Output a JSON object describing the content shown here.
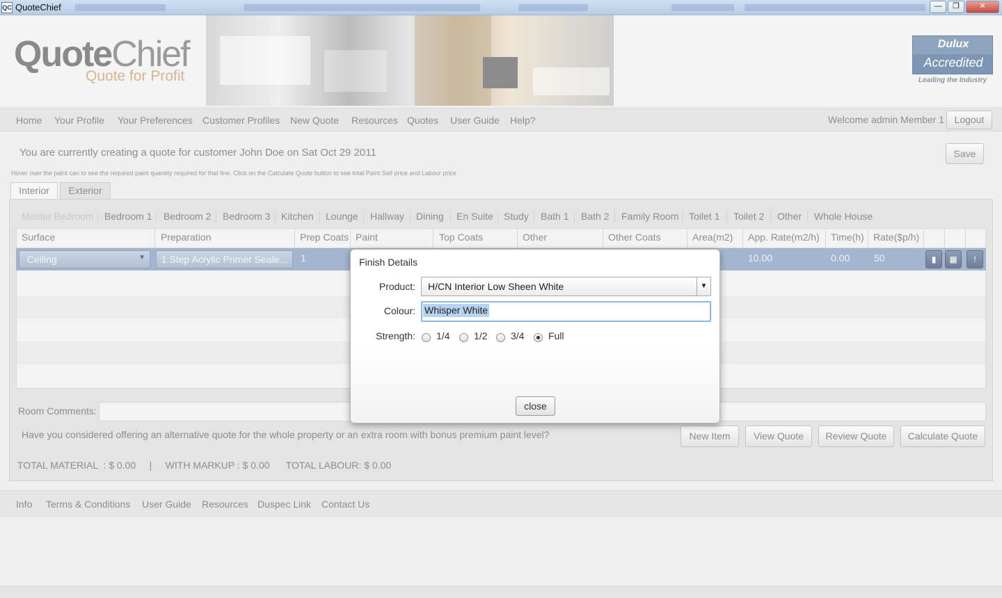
{
  "window": {
    "icon": "QC",
    "title": "QuoteChief",
    "minimize_icon": "minimize-icon",
    "restore_icon": "restore-icon",
    "close_icon": "close-icon"
  },
  "header": {
    "logo_quote": "Quote",
    "logo_chief": "Chief",
    "tagline": "Quote for Profit",
    "badge_brand": "Dulux",
    "badge_title": "Accredited",
    "badge_tagline": "Leading the Industry"
  },
  "nav": {
    "items": [
      "Home",
      "Your Profile",
      "Your Preferences",
      "Customer Profiles",
      "New Quote",
      "Resources",
      "Quotes",
      "User Guide",
      "Help?"
    ],
    "welcome": "Welcome admin Member 1",
    "logout": "Logout"
  },
  "quote": {
    "info": "You are currently creating a quote for customer John  Doe on Sat Oct 29 2011",
    "save": "Save",
    "hint": "Hover over the paint can to see the required paint quantity required for that line. Click on the Calculate Quote button to see total Paint Sell price and Labour price"
  },
  "tabs": [
    "Interior",
    "Exterior"
  ],
  "rooms": [
    "Master Bedroom",
    "Bedroom 1",
    "Bedroom 2",
    "Bedroom 3",
    "Kitchen",
    "Lounge",
    "Hallway",
    "Dining",
    "En Suite",
    "Study",
    "Bath 1",
    "Bath 2",
    "Family Room",
    "Toilet 1",
    "Toilet 2",
    "Other",
    "Whole House"
  ],
  "grid": {
    "columns": [
      "Surface",
      "Preparation",
      "Prep Coats",
      "Paint",
      "Top Coats",
      "Other",
      "Other Coats",
      "Area(m2)",
      "App. Rate(m2/h)",
      "Time(h)",
      "Rate($p/h)"
    ],
    "row": {
      "surface": "Ceiling",
      "preparation": "1 Step Acrylic Primer Seale...",
      "prep_coats": "1",
      "app_rate": "10.00",
      "time": "0.00",
      "rate": "50"
    }
  },
  "bottom": {
    "comments_label": "Room Comments:",
    "alt_quote": "Have you considered offering an alternative quote for the whole property or an extra room with bonus premium paint level?",
    "buttons": [
      "New Item",
      "View Quote",
      "Review Quote",
      "Calculate Quote"
    ],
    "totals": "TOTAL MATERIAL  : $ 0.00     |     WITH MARKUP : $ 0.00      TOTAL LABOUR: $ 0.00"
  },
  "footer": {
    "items": [
      "Info",
      "Terms & Conditions",
      "User Guide",
      "Resources",
      "Duspec Link",
      "Contact Us"
    ]
  },
  "dialog": {
    "title": "Finish Details",
    "product_label": "Product:",
    "product_value": "H/CN Interior Low Sheen White",
    "colour_label": "Colour:",
    "colour_value": "Whisper White",
    "strength_label": "Strength:",
    "strength_options": [
      "1/4",
      "1/2",
      "3/4",
      "Full"
    ],
    "strength_selected": "Full",
    "close": "close"
  }
}
